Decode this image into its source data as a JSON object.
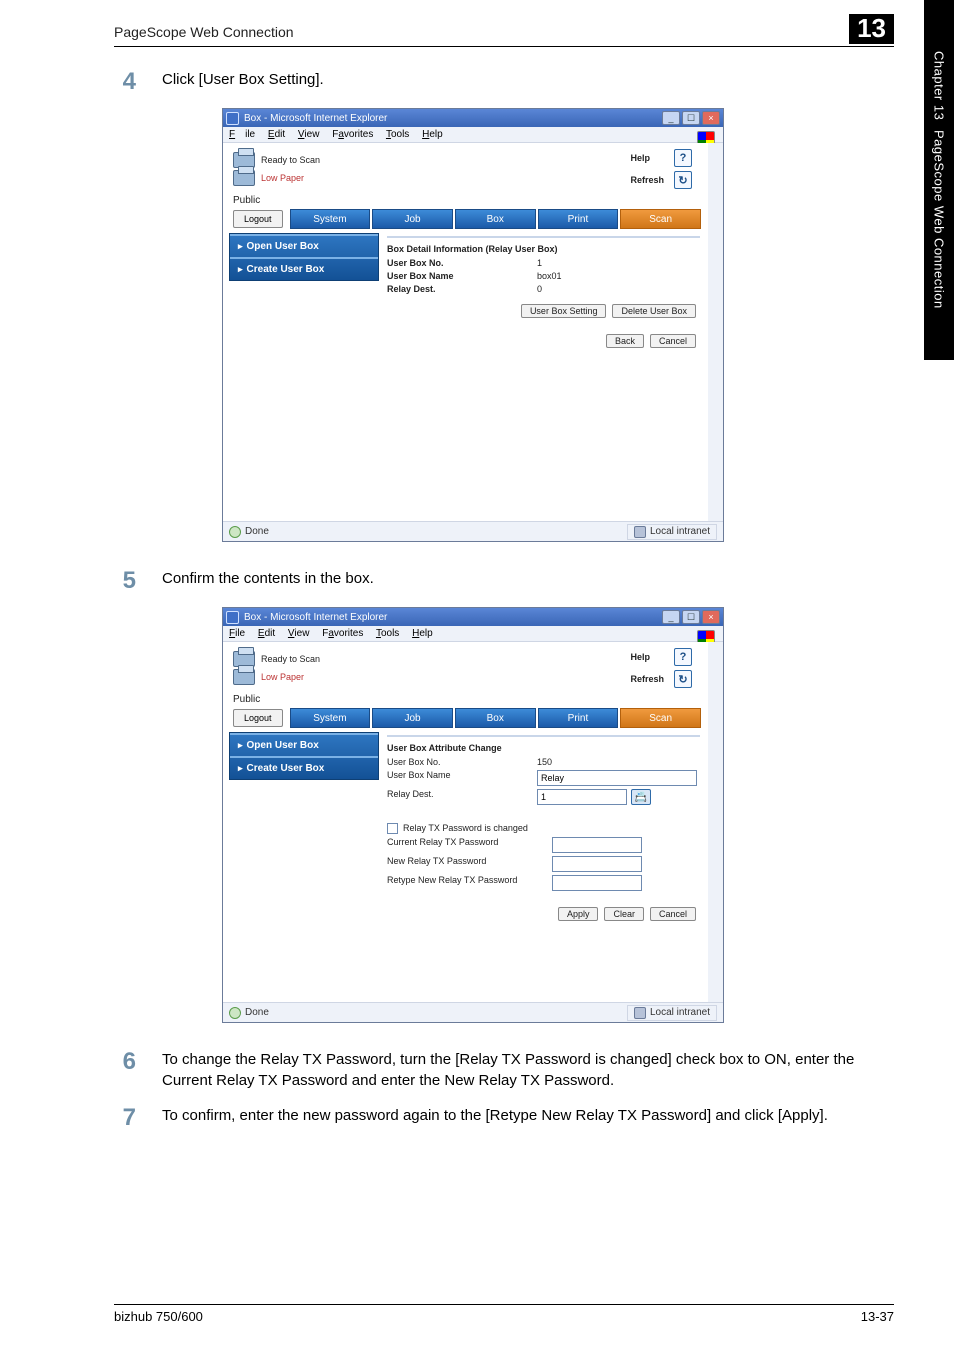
{
  "page": {
    "header": "PageScope Web Connection",
    "chapter_num": "13",
    "side_label_top": "Chapter 13",
    "side_label_bottom": "PageScope Web Connection"
  },
  "steps": {
    "s4": {
      "num": "4",
      "text": "Click [User Box Setting]."
    },
    "s5": {
      "num": "5",
      "text": "Confirm the contents in the box."
    },
    "s6": {
      "num": "6",
      "text": "To change the Relay TX Password, turn the [Relay TX Password is changed] check box to ON, enter the Current Relay TX Password and enter the New Relay TX Password."
    },
    "s7": {
      "num": "7",
      "text": "To confirm, enter the new password again to the [Retype New Relay TX Password] and click [Apply]."
    }
  },
  "ie": {
    "title": "Box - Microsoft Internet Explorer",
    "menubar": {
      "file": "File",
      "edit": "Edit",
      "view": "View",
      "favorites": "Favorites",
      "tools": "Tools",
      "help": "Help"
    },
    "status": {
      "ready": "Ready to Scan",
      "lowpaper": "Low Paper"
    },
    "help": {
      "help": "Help",
      "refresh": "Refresh"
    },
    "public": "Public",
    "logout": "Logout",
    "tabs": {
      "system": "System",
      "job": "Job",
      "box": "Box",
      "print": "Print",
      "scan": "Scan"
    },
    "leftmenu": {
      "open": "Open User Box",
      "create": "Create User Box"
    },
    "statusbar": {
      "done": "Done",
      "zone": "Local intranet"
    }
  },
  "shot1": {
    "title": "Box Detail Information (Relay User Box)",
    "rows": {
      "userboxno_lbl": "User Box No.",
      "userboxno_val": "1",
      "userboxname_lbl": "User Box Name",
      "userboxname_val": "box01",
      "relaydest_lbl": "Relay Dest.",
      "relaydest_val": "0"
    },
    "btns": {
      "setting": "User Box Setting",
      "delete": "Delete User Box",
      "back": "Back",
      "cancel": "Cancel"
    }
  },
  "shot2": {
    "title": "User Box Attribute Change",
    "rows": {
      "userboxno_lbl": "User Box No.",
      "userboxno_val": "150",
      "userboxname_lbl": "User Box Name",
      "userboxname_val": "Relay",
      "relaydest_lbl": "Relay Dest.",
      "relaydest_val": "1"
    },
    "pw": {
      "changed": "Relay TX Password is changed",
      "current": "Current Relay TX Password",
      "newpw": "New Relay TX Password",
      "retype": "Retype New Relay TX Password"
    },
    "btns": {
      "apply": "Apply",
      "clear": "Clear",
      "cancel": "Cancel"
    }
  },
  "footer": {
    "left": "bizhub 750/600",
    "right": "13-37"
  }
}
